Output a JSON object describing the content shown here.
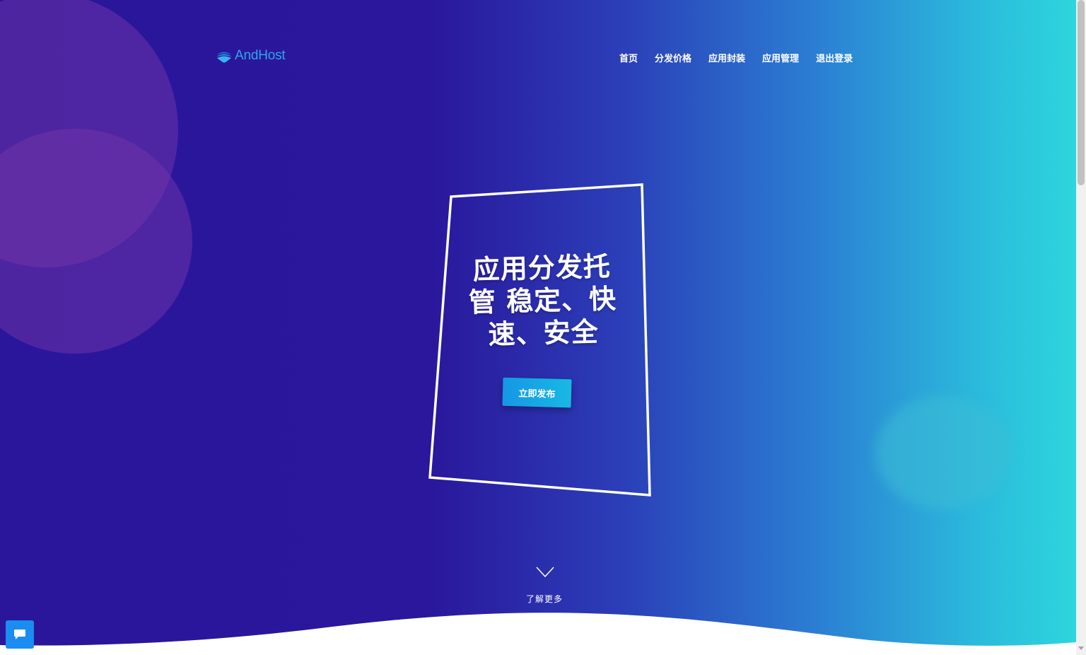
{
  "brand": {
    "name": "AndHost",
    "icon": "layered-cloud-logo-icon",
    "color": "#2fa6ec"
  },
  "nav": {
    "items": [
      {
        "label": "首页"
      },
      {
        "label": "分发价格"
      },
      {
        "label": "应用封装"
      },
      {
        "label": "应用管理"
      },
      {
        "label": "退出登录"
      }
    ]
  },
  "hero": {
    "title_lines": [
      "应用分发托",
      "管 稳定、快",
      "速、安全"
    ],
    "cta_label": "立即发布",
    "learn_more_label": "了解更多",
    "scroll_icon": "chevron-down-icon"
  },
  "chat": {
    "icon": "chat-bubble-icon"
  },
  "colors": {
    "gradient_start": "#2a169a",
    "gradient_end": "#2dd6dc",
    "cta": "#1597e6",
    "chat": "#1a8cf2"
  }
}
